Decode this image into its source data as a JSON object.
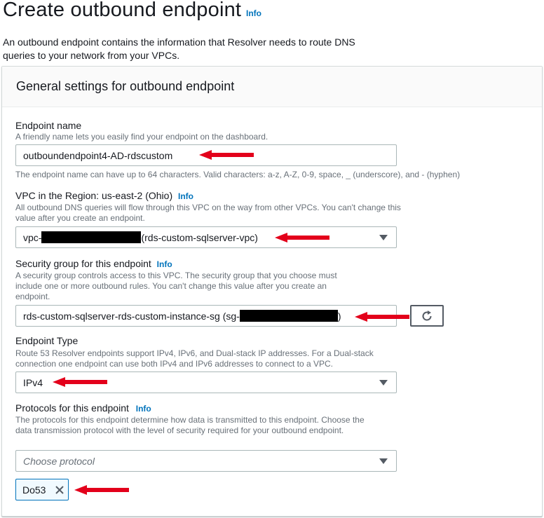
{
  "page": {
    "title": "Create outbound endpoint",
    "title_info": "Info",
    "intro": "An outbound endpoint contains the information that Resolver needs to route DNS queries to your network from your VPCs."
  },
  "section": {
    "title": "General settings for outbound endpoint"
  },
  "endpoint_name": {
    "label": "Endpoint name",
    "description": "A friendly name lets you easily find your endpoint on the dashboard.",
    "value": "outboundendpoint4-AD-rdscustom",
    "constraint": "The endpoint name can have up to 64 characters. Valid characters: a-z, A-Z, 0-9, space, _ (underscore), and - (hyphen)"
  },
  "vpc": {
    "label": "VPC in the Region: us-east-2 (Ohio)",
    "info": "Info",
    "description": "All outbound DNS queries will flow through this VPC on the way from other VPCs. You can't change this value after you create an endpoint.",
    "value_prefix": "vpc-",
    "value_suffix": "(rds-custom-sqlserver-vpc)"
  },
  "security_group": {
    "label": "Security group for this endpoint",
    "info": "Info",
    "description": "A security group controls access to this VPC. The security group that you choose must include one or more outbound rules. You can't change this value after you create an endpoint.",
    "value_prefix": "rds-custom-sqlserver-rds-custom-instance-sg (sg-",
    "value_suffix": ")"
  },
  "endpoint_type": {
    "label": "Endpoint Type",
    "description": "Route 53 Resolver endpoints support IPv4, IPv6, and Dual-stack IP addresses. For a Dual-stack connection one endpoint can use both IPv4 and IPv6 addresses to connect to a VPC.",
    "value": "IPv4"
  },
  "protocols": {
    "label": "Protocols for this endpoint",
    "info": "Info",
    "description": "The protocols for this endpoint determine how data is transmitted to this endpoint. Choose the data transmission protocol with the level of security required for your outbound endpoint.",
    "placeholder": "Choose protocol",
    "selected": [
      "Do53"
    ]
  },
  "colors": {
    "annotation_arrow": "#e3001b",
    "link": "#0073bb",
    "token_border": "#0073bb"
  },
  "icons": [
    "refresh-icon",
    "close-icon",
    "caret-down-icon",
    "arrow-annotation"
  ]
}
